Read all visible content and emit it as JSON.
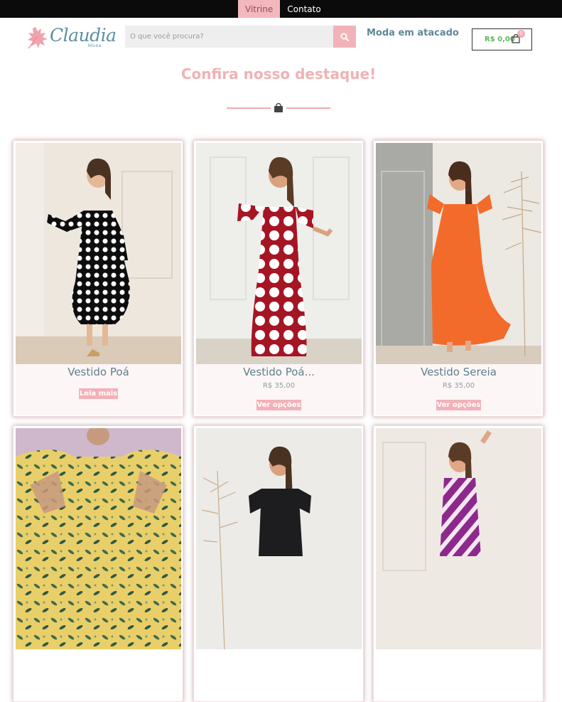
{
  "nav": {
    "items": [
      {
        "label": "Vitrine"
      },
      {
        "label": "Contato"
      }
    ]
  },
  "brand": {
    "name": "Claudia",
    "tagline": "Moda"
  },
  "search": {
    "placeholder": "O que você procura?"
  },
  "header": {
    "wholesale_link": "Moda em atacado"
  },
  "cart": {
    "total": "R$ 0,00",
    "count": "0"
  },
  "main": {
    "headline": "Confira nosso destaque!"
  },
  "products": [
    {
      "name": "Vestido Poá",
      "price": "",
      "button": "Leia mais"
    },
    {
      "name": "Vestido Poá...",
      "price": "R$ 35,00",
      "button": "Ver opções"
    },
    {
      "name": "Vestido Sereia",
      "price": "R$ 35,00",
      "button": "Ver opções"
    },
    {
      "name": "",
      "price": "",
      "button": ""
    },
    {
      "name": "",
      "price": "",
      "button": ""
    },
    {
      "name": "",
      "price": "",
      "button": ""
    }
  ],
  "colors": {
    "accent": "#f2b1b8",
    "topbar": "#0b0b0b",
    "teal": "#5f8898",
    "cart_price": "#5fb85f"
  }
}
